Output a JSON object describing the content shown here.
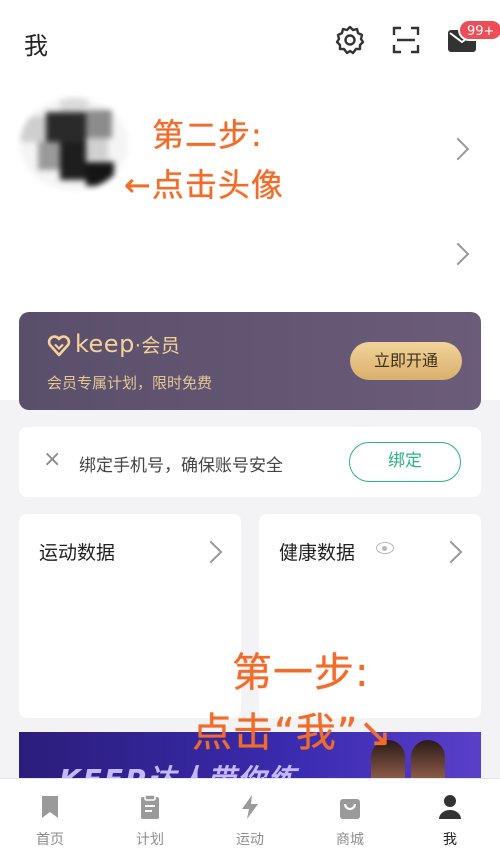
{
  "header": {
    "title": "我",
    "icons": [
      "settings-icon",
      "scan-icon",
      "message-icon"
    ],
    "message_badge": "99+"
  },
  "profile": {
    "annotation_line1": "第二步:",
    "annotation_line2": "←点击头像"
  },
  "member": {
    "brand": "keep",
    "brand_suffix": "·会员",
    "subtitle": "会员专属计划，限时免费",
    "button": "立即开通"
  },
  "bind_phone": {
    "text": "绑定手机号，确保账号安全",
    "button": "绑定",
    "close": "×"
  },
  "cards": {
    "sport_title": "运动数据",
    "health_title": "健康数据"
  },
  "annotation_step1": {
    "line1": "第一步:",
    "line2": "点击“我”↘"
  },
  "banner": {
    "text": "KEEP达人带你练"
  },
  "tabbar": {
    "items": [
      {
        "label": "首页",
        "icon": "bookmark-icon"
      },
      {
        "label": "计划",
        "icon": "clipboard-icon"
      },
      {
        "label": "运动",
        "icon": "lightning-icon"
      },
      {
        "label": "商城",
        "icon": "shopping-bag-icon"
      },
      {
        "label": "我",
        "icon": "person-icon",
        "active": true
      }
    ]
  },
  "colors": {
    "accent_green": "#2bb388",
    "gold": "#f3d39a",
    "annotation": "#f06c2a",
    "badge": "#ec4e57"
  }
}
